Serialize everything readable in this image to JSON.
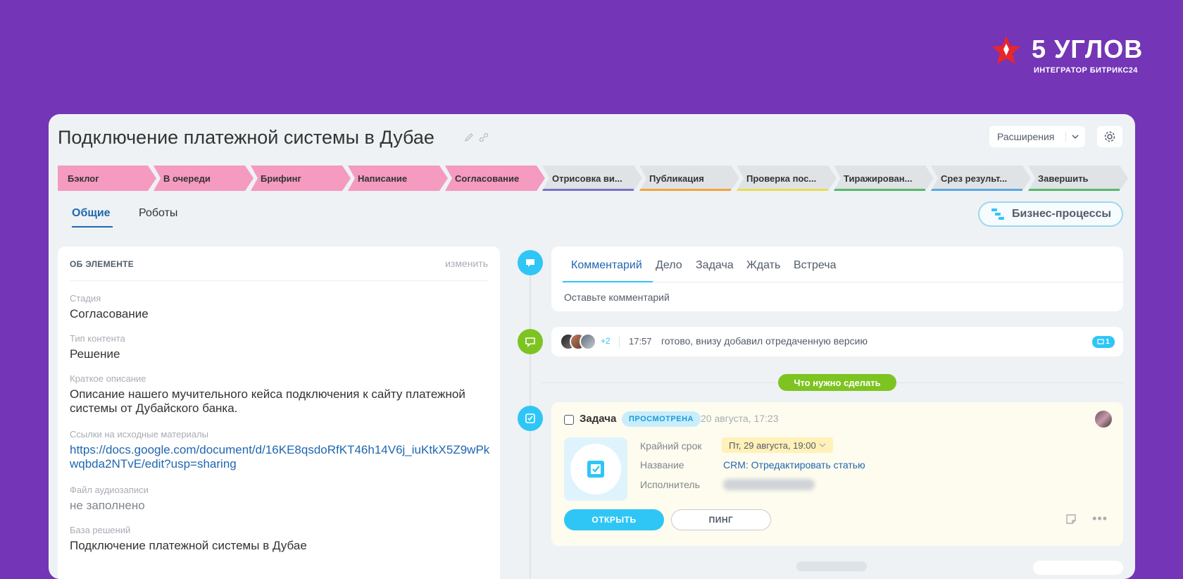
{
  "brand": {
    "title": "5 УГЛОВ",
    "subtitle": "ИНТЕГРАТОР БИТРИКС24",
    "colors": {
      "background": "#7435b7",
      "accent": "#2fc6f6"
    }
  },
  "header": {
    "title": "Подключение платежной системы в Дубае",
    "extensions_label": "Расширения",
    "icons": [
      "pencil-icon",
      "link-icon",
      "gear-icon",
      "chevron-down-icon"
    ]
  },
  "stages": [
    {
      "label": "Бэклог",
      "color": "#f59ac0",
      "state": "passed"
    },
    {
      "label": "В очереди",
      "color": "#f59ac0",
      "state": "passed"
    },
    {
      "label": "Брифинг",
      "color": "#f59ac0",
      "state": "passed"
    },
    {
      "label": "Написание",
      "color": "#f59ac0",
      "state": "passed"
    },
    {
      "label": "Согласование",
      "color": "#f59ac0",
      "state": "current"
    },
    {
      "label": "Отрисовка ви...",
      "color": "#7a72c9",
      "state": "future"
    },
    {
      "label": "Публикация",
      "color": "#f5a340",
      "state": "future"
    },
    {
      "label": "Проверка пос...",
      "color": "#e8dd52",
      "state": "future"
    },
    {
      "label": "Тиражирован...",
      "color": "#58b96a",
      "state": "future"
    },
    {
      "label": "Срез результ...",
      "color": "#5aa8e0",
      "state": "future"
    },
    {
      "label": "Завершить",
      "color": "#58b96a",
      "state": "future"
    }
  ],
  "tabs": [
    {
      "label": "Общие",
      "active": true
    },
    {
      "label": "Роботы",
      "active": false
    }
  ],
  "bp_button": "Бизнес-процессы",
  "about": {
    "heading": "ОБ ЭЛЕМЕНТЕ",
    "edit": "изменить",
    "fields": [
      {
        "label": "Стадия",
        "value": "Согласование"
      },
      {
        "label": "Тип контента",
        "value": "Решение"
      },
      {
        "label": "Краткое описание",
        "value": "Описание нашего мучительного кейса подключения к сайту платежной системы от Дубайского банка."
      },
      {
        "label": "Ссылки на исходные материалы",
        "value": "https://docs.google.com/document/d/16KE8qsdoRfKT46h14V6j_iuKtkX5Z9wPkwqbda2NTvE/edit?usp=sharing"
      },
      {
        "label": "Файл аудиозаписи",
        "value": "не заполнено"
      },
      {
        "label": "База решений",
        "value": "Подключение платежной системы в Дубае"
      }
    ]
  },
  "comment": {
    "tabs": [
      "Комментарий",
      "Дело",
      "Задача",
      "Ждать",
      "Встреча"
    ],
    "placeholder": "Оставьте комментарий"
  },
  "history": {
    "more": "+2",
    "time": "17:57",
    "text": "готово, внизу добавил отредаченную версию",
    "count": "1"
  },
  "todo_label": "Что нужно сделать",
  "task": {
    "title": "Задача",
    "status": "ПРОСМОТРЕНА",
    "date": "20 августа, 17:23",
    "deadline_label": "Крайний срок",
    "deadline_value": "Пт, 29 августа, 19:00",
    "name_label": "Название",
    "name_value": "CRM: Отредактировать статью",
    "assignee_label": "Исполнитель",
    "open_button": "ОТКРЫТЬ",
    "ping_button": "ПИНГ"
  }
}
